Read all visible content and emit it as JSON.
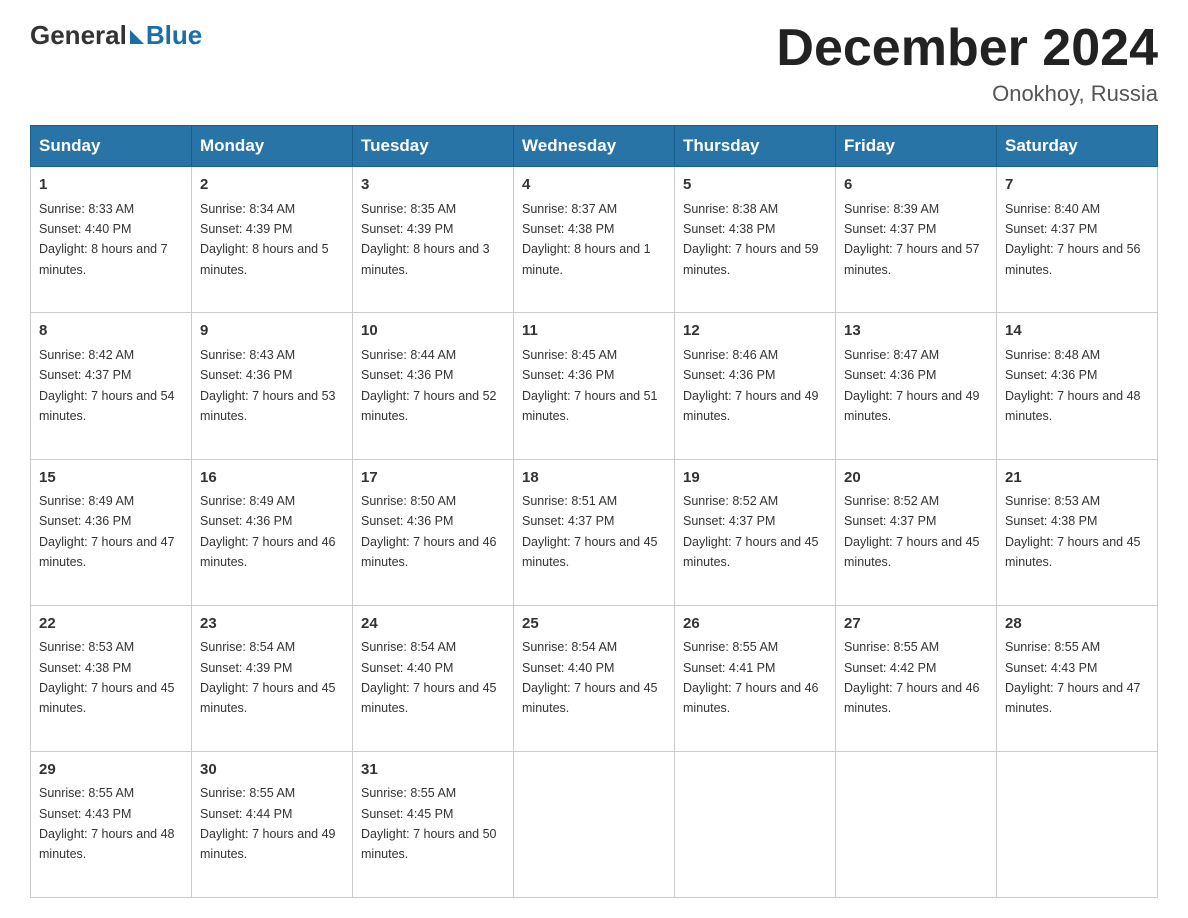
{
  "header": {
    "logo_general": "General",
    "logo_blue": "Blue",
    "month_title": "December 2024",
    "location": "Onokhoy, Russia"
  },
  "columns": [
    "Sunday",
    "Monday",
    "Tuesday",
    "Wednesday",
    "Thursday",
    "Friday",
    "Saturday"
  ],
  "weeks": [
    [
      {
        "day": "1",
        "sunrise": "8:33 AM",
        "sunset": "4:40 PM",
        "daylight": "8 hours and 7 minutes."
      },
      {
        "day": "2",
        "sunrise": "8:34 AM",
        "sunset": "4:39 PM",
        "daylight": "8 hours and 5 minutes."
      },
      {
        "day": "3",
        "sunrise": "8:35 AM",
        "sunset": "4:39 PM",
        "daylight": "8 hours and 3 minutes."
      },
      {
        "day": "4",
        "sunrise": "8:37 AM",
        "sunset": "4:38 PM",
        "daylight": "8 hours and 1 minute."
      },
      {
        "day": "5",
        "sunrise": "8:38 AM",
        "sunset": "4:38 PM",
        "daylight": "7 hours and 59 minutes."
      },
      {
        "day": "6",
        "sunrise": "8:39 AM",
        "sunset": "4:37 PM",
        "daylight": "7 hours and 57 minutes."
      },
      {
        "day": "7",
        "sunrise": "8:40 AM",
        "sunset": "4:37 PM",
        "daylight": "7 hours and 56 minutes."
      }
    ],
    [
      {
        "day": "8",
        "sunrise": "8:42 AM",
        "sunset": "4:37 PM",
        "daylight": "7 hours and 54 minutes."
      },
      {
        "day": "9",
        "sunrise": "8:43 AM",
        "sunset": "4:36 PM",
        "daylight": "7 hours and 53 minutes."
      },
      {
        "day": "10",
        "sunrise": "8:44 AM",
        "sunset": "4:36 PM",
        "daylight": "7 hours and 52 minutes."
      },
      {
        "day": "11",
        "sunrise": "8:45 AM",
        "sunset": "4:36 PM",
        "daylight": "7 hours and 51 minutes."
      },
      {
        "day": "12",
        "sunrise": "8:46 AM",
        "sunset": "4:36 PM",
        "daylight": "7 hours and 49 minutes."
      },
      {
        "day": "13",
        "sunrise": "8:47 AM",
        "sunset": "4:36 PM",
        "daylight": "7 hours and 49 minutes."
      },
      {
        "day": "14",
        "sunrise": "8:48 AM",
        "sunset": "4:36 PM",
        "daylight": "7 hours and 48 minutes."
      }
    ],
    [
      {
        "day": "15",
        "sunrise": "8:49 AM",
        "sunset": "4:36 PM",
        "daylight": "7 hours and 47 minutes."
      },
      {
        "day": "16",
        "sunrise": "8:49 AM",
        "sunset": "4:36 PM",
        "daylight": "7 hours and 46 minutes."
      },
      {
        "day": "17",
        "sunrise": "8:50 AM",
        "sunset": "4:36 PM",
        "daylight": "7 hours and 46 minutes."
      },
      {
        "day": "18",
        "sunrise": "8:51 AM",
        "sunset": "4:37 PM",
        "daylight": "7 hours and 45 minutes."
      },
      {
        "day": "19",
        "sunrise": "8:52 AM",
        "sunset": "4:37 PM",
        "daylight": "7 hours and 45 minutes."
      },
      {
        "day": "20",
        "sunrise": "8:52 AM",
        "sunset": "4:37 PM",
        "daylight": "7 hours and 45 minutes."
      },
      {
        "day": "21",
        "sunrise": "8:53 AM",
        "sunset": "4:38 PM",
        "daylight": "7 hours and 45 minutes."
      }
    ],
    [
      {
        "day": "22",
        "sunrise": "8:53 AM",
        "sunset": "4:38 PM",
        "daylight": "7 hours and 45 minutes."
      },
      {
        "day": "23",
        "sunrise": "8:54 AM",
        "sunset": "4:39 PM",
        "daylight": "7 hours and 45 minutes."
      },
      {
        "day": "24",
        "sunrise": "8:54 AM",
        "sunset": "4:40 PM",
        "daylight": "7 hours and 45 minutes."
      },
      {
        "day": "25",
        "sunrise": "8:54 AM",
        "sunset": "4:40 PM",
        "daylight": "7 hours and 45 minutes."
      },
      {
        "day": "26",
        "sunrise": "8:55 AM",
        "sunset": "4:41 PM",
        "daylight": "7 hours and 46 minutes."
      },
      {
        "day": "27",
        "sunrise": "8:55 AM",
        "sunset": "4:42 PM",
        "daylight": "7 hours and 46 minutes."
      },
      {
        "day": "28",
        "sunrise": "8:55 AM",
        "sunset": "4:43 PM",
        "daylight": "7 hours and 47 minutes."
      }
    ],
    [
      {
        "day": "29",
        "sunrise": "8:55 AM",
        "sunset": "4:43 PM",
        "daylight": "7 hours and 48 minutes."
      },
      {
        "day": "30",
        "sunrise": "8:55 AM",
        "sunset": "4:44 PM",
        "daylight": "7 hours and 49 minutes."
      },
      {
        "day": "31",
        "sunrise": "8:55 AM",
        "sunset": "4:45 PM",
        "daylight": "7 hours and 50 minutes."
      },
      null,
      null,
      null,
      null
    ]
  ],
  "labels": {
    "sunrise": "Sunrise:",
    "sunset": "Sunset:",
    "daylight": "Daylight:"
  }
}
